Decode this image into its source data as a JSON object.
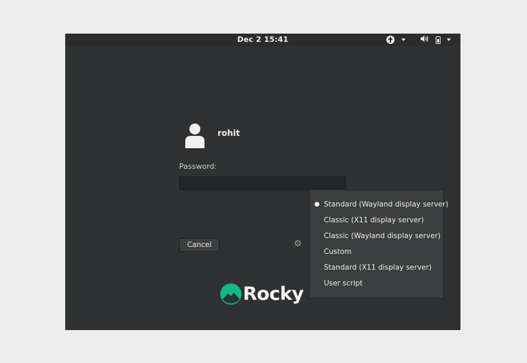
{
  "topbar": {
    "clock": "Dec 2  15:41",
    "icons": [
      "accessibility-icon",
      "volume-icon",
      "battery-icon"
    ]
  },
  "login": {
    "username": "rohit",
    "password_label": "Password:",
    "password_value": "",
    "cancel_label": "Cancel"
  },
  "logo": {
    "text": "Rocky",
    "brand_color": "#10b981"
  },
  "session_menu": {
    "selected_index": 0,
    "items": [
      {
        "label": "Standard (Wayland display server)"
      },
      {
        "label": "Classic (X11 display server)"
      },
      {
        "label": "Classic (Wayland display server)"
      },
      {
        "label": "Custom"
      },
      {
        "label": "Standard (X11 display server)"
      },
      {
        "label": "User script"
      }
    ]
  }
}
